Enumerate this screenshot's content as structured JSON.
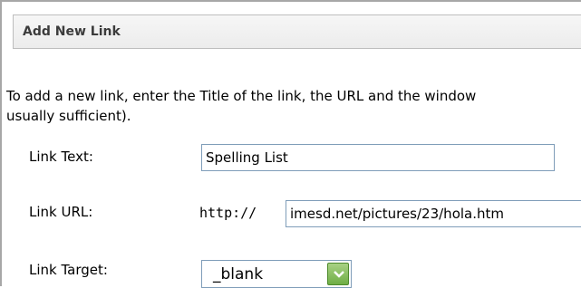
{
  "panel": {
    "title": "Add New Link",
    "intro_line1": "To add a new link, enter the Title of the link, the URL and the window",
    "intro_line2": "usually sufficient)."
  },
  "form": {
    "link_text": {
      "label": "Link Text:",
      "value": "Spelling List"
    },
    "link_url": {
      "label": "Link URL:",
      "prefix": "http://",
      "value": "imesd.net/pictures/23/hola.htm"
    },
    "link_target": {
      "label": "Link Target:",
      "selected": "_blank"
    }
  },
  "icons": {
    "dropdown": "chevron-down-icon"
  },
  "colors": {
    "header_bg": "#ececec",
    "input_border": "#7f9db9",
    "dropdown_button": "#6fae45"
  }
}
